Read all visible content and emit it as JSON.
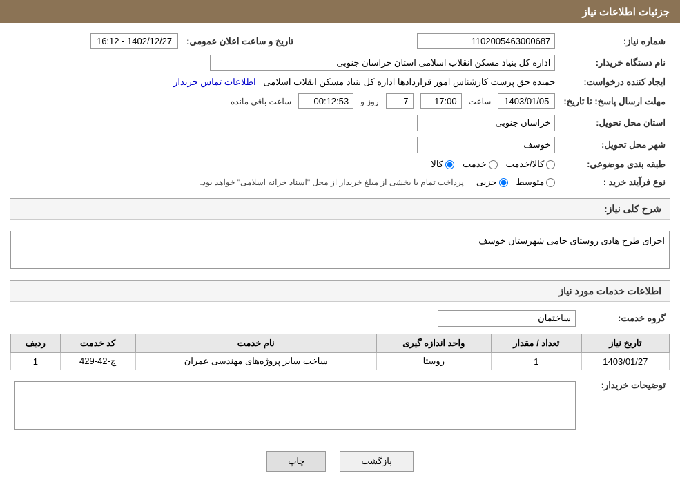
{
  "page": {
    "title": "جزئیات اطلاعات نیاز",
    "header_bg": "#8B7355"
  },
  "labels": {
    "need_number": "شماره نیاز:",
    "buyer_org": "نام دستگاه خریدار:",
    "creator": "ایجاد کننده درخواست:",
    "deadline": "مهلت ارسال پاسخ: تا تاریخ:",
    "province": "استان محل تحویل:",
    "city": "شهر محل تحویل:",
    "category": "طبقه بندی موضوعی:",
    "purchase_type": "نوع فرآیند خرید :",
    "need_description": "شرح کلی نیاز:",
    "services_section": "اطلاعات خدمات مورد نیاز",
    "service_group": "گروه خدمت:",
    "buyer_notes": "توضیحات خریدار:",
    "public_announcement": "تاریخ و ساعت اعلان عمومی:",
    "row": "ردیف",
    "service_code": "کد خدمت",
    "service_name": "نام خدمت",
    "unit": "واحد اندازه گیری",
    "quantity": "تعداد / مقدار",
    "need_date": "تاریخ نیاز"
  },
  "values": {
    "need_number": "1102005463000687",
    "buyer_org": "اداره کل بنیاد مسکن انقلاب اسلامی استان خراسان جنوبی",
    "creator": "حمیده حق پرست کارشناس امور قراردادها اداره کل بنیاد مسکن انقلاب اسلامی",
    "contact_info_link": "اطلاعات تماس خریدار",
    "announcement_date": "1402/12/27 - 16:12",
    "deadline_date": "1403/01/05",
    "deadline_time": "17:00",
    "deadline_days": "7",
    "remaining_time": "00:12:53",
    "province": "خراسان جنوبی",
    "city": "خوسف",
    "category_options": [
      "کالا",
      "خدمت",
      "کالا/خدمت"
    ],
    "category_selected": "کالا",
    "purchase_type_options": [
      "جزیی",
      "متوسط"
    ],
    "purchase_type_note": "پرداخت تمام یا بخشی از مبلغ خریدار از محل \"اسناد خزانه اسلامی\" خواهد بود.",
    "need_description_text": "اجرای طرح هادی روستای حامی شهرستان خوسف",
    "service_group_value": "ساختمان",
    "services": [
      {
        "row": "1",
        "code": "ج-42-429",
        "name": "ساخت سایر پروژه‌های مهندسی عمران",
        "unit": "روستا",
        "quantity": "1",
        "date": "1403/01/27"
      }
    ],
    "buyer_notes_text": "",
    "days_label": "روز و",
    "time_label": "ساعت",
    "remaining_label": "ساعت باقی مانده"
  },
  "buttons": {
    "print": "چاپ",
    "back": "بازگشت"
  }
}
